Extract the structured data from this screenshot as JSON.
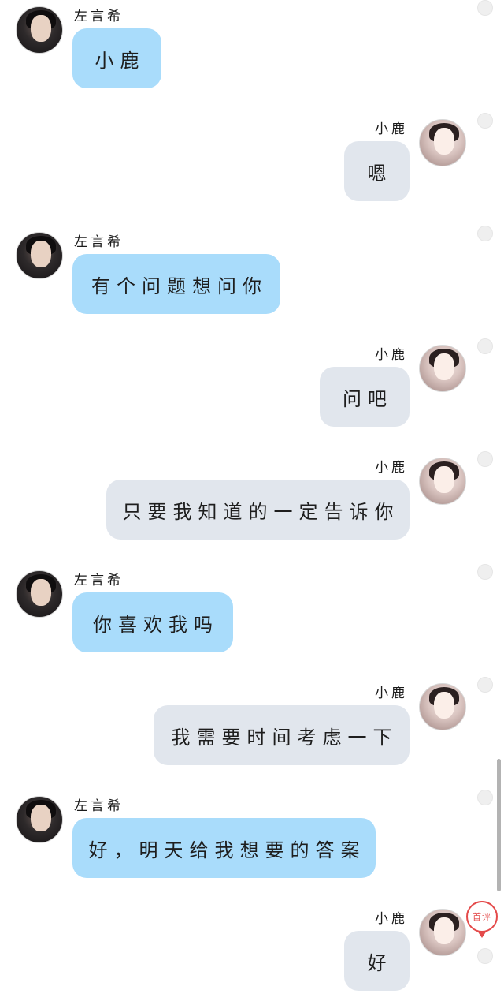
{
  "messages": [
    {
      "side": "left",
      "name": "左言希",
      "text": "小鹿"
    },
    {
      "side": "right",
      "name": "小鹿",
      "text": "嗯"
    },
    {
      "side": "left",
      "name": "左言希",
      "text": "有个问题想问你"
    },
    {
      "side": "right",
      "name": "小鹿",
      "text": "问吧"
    },
    {
      "side": "right",
      "name": "小鹿",
      "text": "只要我知道的一定告诉你"
    },
    {
      "side": "left",
      "name": "左言希",
      "text": "你喜欢我吗"
    },
    {
      "side": "right",
      "name": "小鹿",
      "text": "我需要时间考虑一下"
    },
    {
      "side": "left",
      "name": "左言希",
      "text": "好，明天给我想要的答案"
    },
    {
      "side": "right",
      "name": "小鹿",
      "text": "好"
    }
  ],
  "badge": {
    "label": "首评",
    "icon": "map-pin-icon"
  },
  "colors": {
    "left_bubble": "#a9dcfb",
    "right_bubble": "#e1e6ed"
  }
}
